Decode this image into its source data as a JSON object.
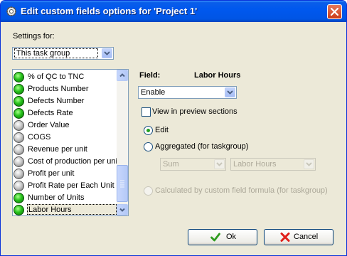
{
  "window": {
    "title": "Edit custom fields options for  'Project 1'"
  },
  "settings": {
    "label": "Settings for:",
    "selected": "This task group"
  },
  "list": {
    "items": [
      {
        "label": "% of QC to TNC",
        "status": "green"
      },
      {
        "label": "Products Number",
        "status": "green"
      },
      {
        "label": "Defects Number",
        "status": "green"
      },
      {
        "label": "Defects Rate",
        "status": "green"
      },
      {
        "label": "Order Value",
        "status": "grey"
      },
      {
        "label": "COGS",
        "status": "grey"
      },
      {
        "label": "Revenue per unit",
        "status": "grey"
      },
      {
        "label": "Cost of production per unit",
        "status": "grey"
      },
      {
        "label": "Profit per unit",
        "status": "grey"
      },
      {
        "label": "Profit Rate per Each Unit Sold",
        "status": "grey"
      },
      {
        "label": "Number of Units",
        "status": "green"
      },
      {
        "label": "Labor Hours",
        "status": "green",
        "selected": true
      }
    ]
  },
  "field": {
    "label": "Field:",
    "name": "Labor Hours"
  },
  "enable": {
    "selected": "Enable"
  },
  "preview": {
    "label": "View in preview sections",
    "checked": false
  },
  "mode": {
    "edit_label": "Edit",
    "aggregated_label": "Aggregated (for taskgroup)",
    "calculated_label": "Calculated by custom field formula (for taskgroup)",
    "selected": "Edit"
  },
  "aggregate": {
    "function": "Sum",
    "field": "Labor Hours"
  },
  "buttons": {
    "ok": "Ok",
    "cancel": "Cancel"
  },
  "colors": {
    "titlebar": "#0058ee",
    "dialog_bg": "#ece9d8",
    "status_on": "#27c21c",
    "status_off": "#c9c9c9",
    "cancel_icon": "#e0201a",
    "ok_icon": "#2f9c1f"
  }
}
